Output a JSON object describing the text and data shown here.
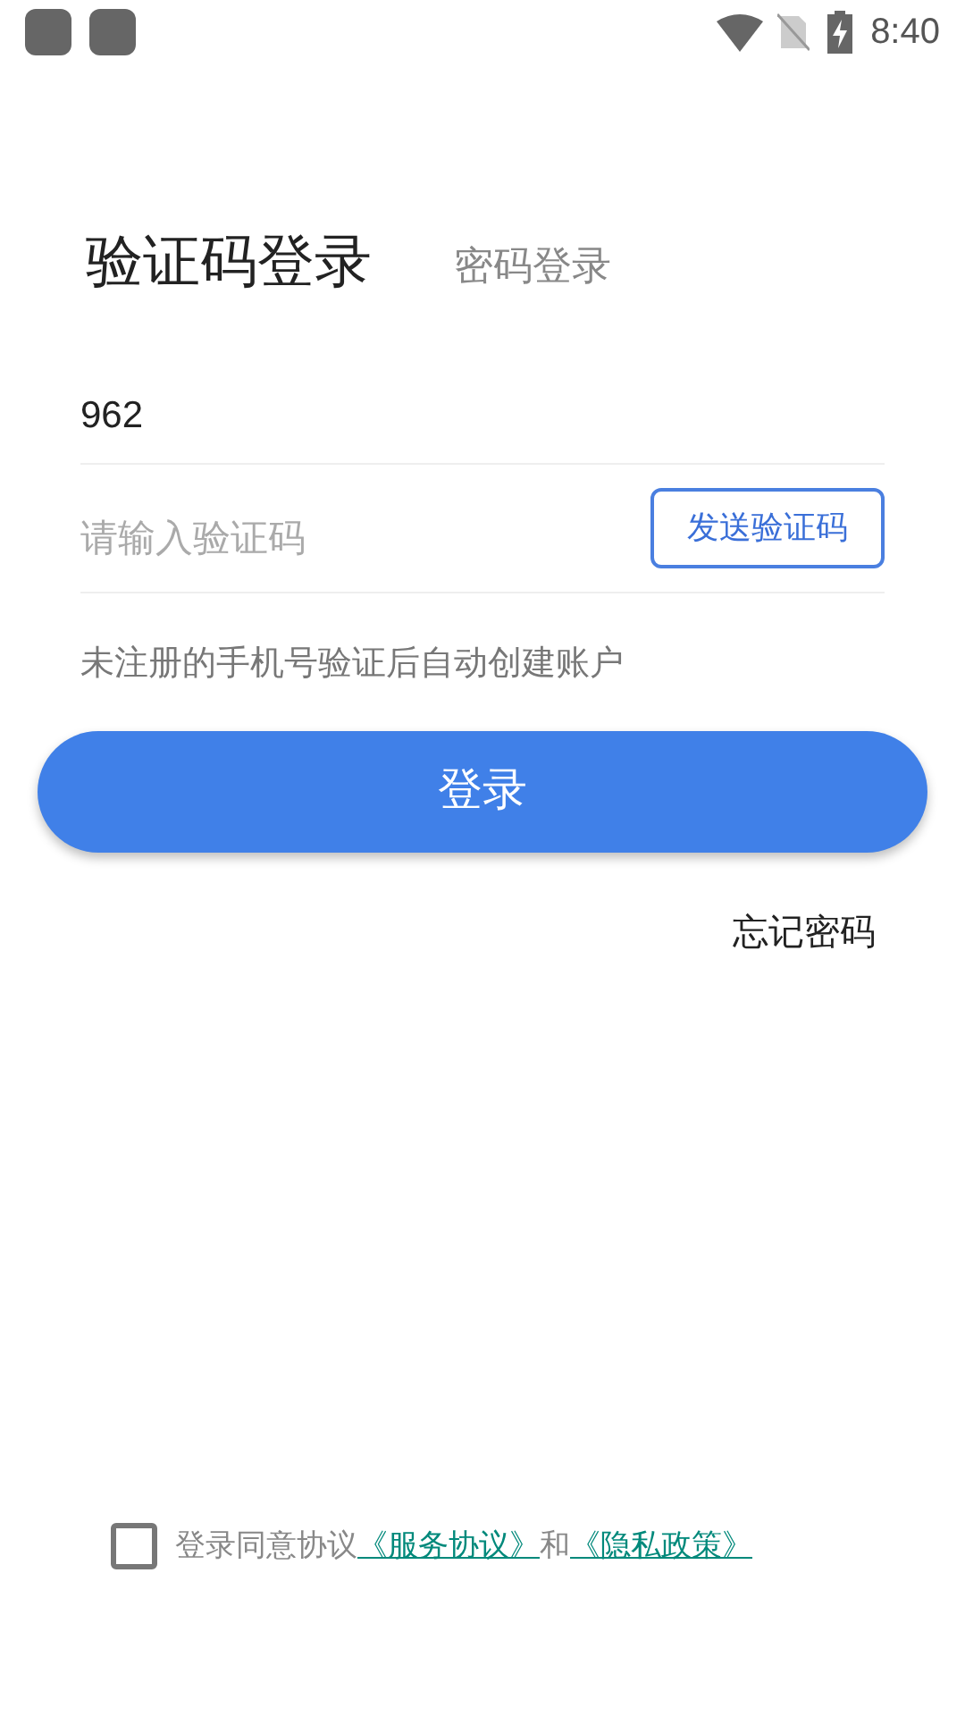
{
  "status_bar": {
    "time": "8:40"
  },
  "tabs": [
    {
      "label": "验证码登录",
      "selected": true
    },
    {
      "label": "密码登录",
      "selected": false
    }
  ],
  "phone_field": {
    "value": "962"
  },
  "code_field": {
    "placeholder": "请输入验证码"
  },
  "send_code_button": "发送验证码",
  "hint": "未注册的手机号验证后自动创建账户",
  "login_button": "登录",
  "forgot_password": "忘记密码",
  "agreement": {
    "checked": false,
    "text": "登录同意协议",
    "link_1": "《服务协议》",
    "connector": "和",
    "link_2": "《隐私政策》"
  }
}
